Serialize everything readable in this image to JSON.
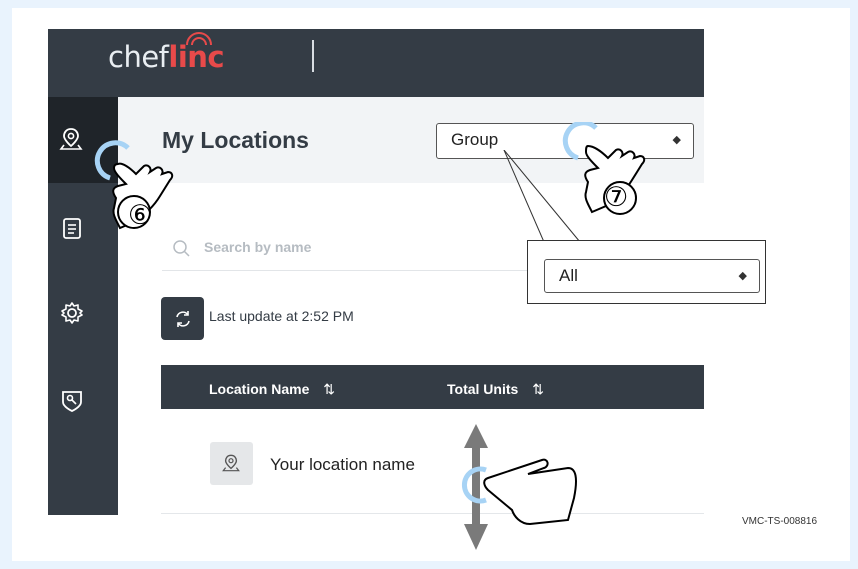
{
  "app": {
    "logo_part1": "chef",
    "logo_part2": "linc"
  },
  "page": {
    "title": "My Locations"
  },
  "filters": {
    "group_select": "Group",
    "group_dropdown_value": "All"
  },
  "search": {
    "placeholder": "Search by name"
  },
  "status": {
    "last_update": "Last update at 2:52 PM"
  },
  "table": {
    "columns": [
      {
        "label": "Location Name",
        "sort_icon": "⇅"
      },
      {
        "label": "Total Units",
        "sort_icon": "⇅"
      }
    ],
    "rows": [
      {
        "name": "Your location name"
      }
    ]
  },
  "sidebar": {
    "items": [
      {
        "icon": "location-pin-icon",
        "active": true
      },
      {
        "icon": "document-icon",
        "active": false
      },
      {
        "icon": "gear-icon",
        "active": false
      },
      {
        "icon": "key-badge-icon",
        "active": false
      }
    ]
  },
  "annotations": {
    "step6": "⑥",
    "step7": "⑦"
  },
  "footer": {
    "doc_id": "VMC-TS-008816"
  },
  "colors": {
    "dark": "#343c45",
    "brand_red": "#e84a4a",
    "highlight_blue": "#a7d3f5"
  }
}
